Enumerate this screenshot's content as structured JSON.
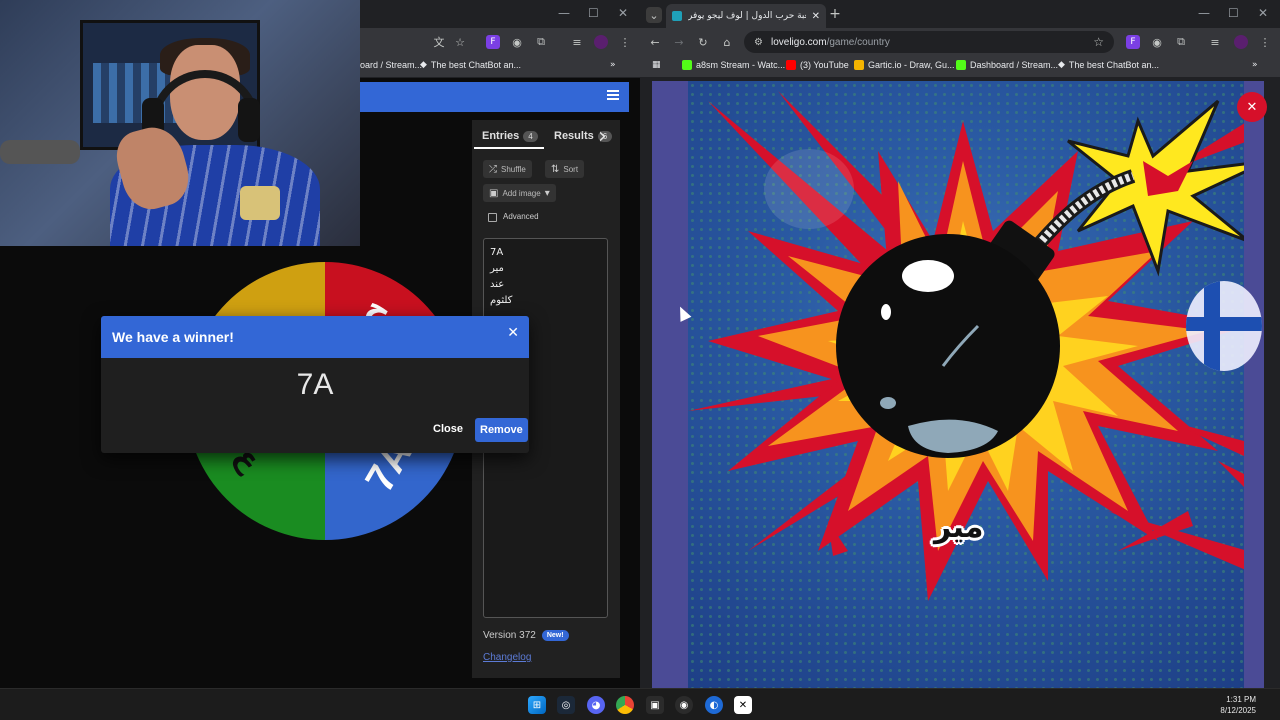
{
  "left_browser": {
    "bookmarks": [
      {
        "label": "oard / Stream..."
      },
      {
        "label": "The best ChatBot an..."
      }
    ]
  },
  "wheel": {
    "letters": [
      "7A",
      "ج",
      "7A"
    ]
  },
  "panel": {
    "tab_entries": "Entries",
    "tab_entries_count": "4",
    "tab_results": "Results",
    "tab_results_count": "6",
    "shuffle_label": "Shuffle",
    "sort_label": "Sort",
    "add_image_label": "Add image",
    "advanced_label": "Advanced",
    "entries": [
      "7A",
      "مير",
      "عند",
      "كلثوم"
    ],
    "version": "Version 372",
    "new_badge": "New!",
    "changelog": "Changelog"
  },
  "dialog": {
    "title": "We have a winner!",
    "winner": "7A",
    "close_label": "Close",
    "remove_label": "Remove"
  },
  "right_browser": {
    "tab_title": "لعبة حرب الدول | لوف ليجو يوفر",
    "url_domain": "loveligo.com",
    "url_path": "/game/country",
    "bookmarks": [
      {
        "label": "a8sm Stream - Watc...",
        "color": "#53fc18"
      },
      {
        "label": "(3) YouTube",
        "color": "#ff0000"
      },
      {
        "label": "Gartic.io - Draw, Gu...",
        "color": "#f4b400"
      },
      {
        "label": "Dashboard / Stream...",
        "color": "#53fc18"
      },
      {
        "label": "The best ChatBot an...",
        "color": "#ffffff"
      }
    ]
  },
  "game": {
    "close_icon": "close-icon",
    "bomb_label": "مير",
    "colors": {
      "frame": "#4b4b96",
      "burst_red": "#d6102a",
      "burst_orange": "#f7931e",
      "burst_yellow": "#ffd21f"
    }
  },
  "taskbar": {
    "time": "1:31 PM",
    "date": "8/12/2025"
  }
}
